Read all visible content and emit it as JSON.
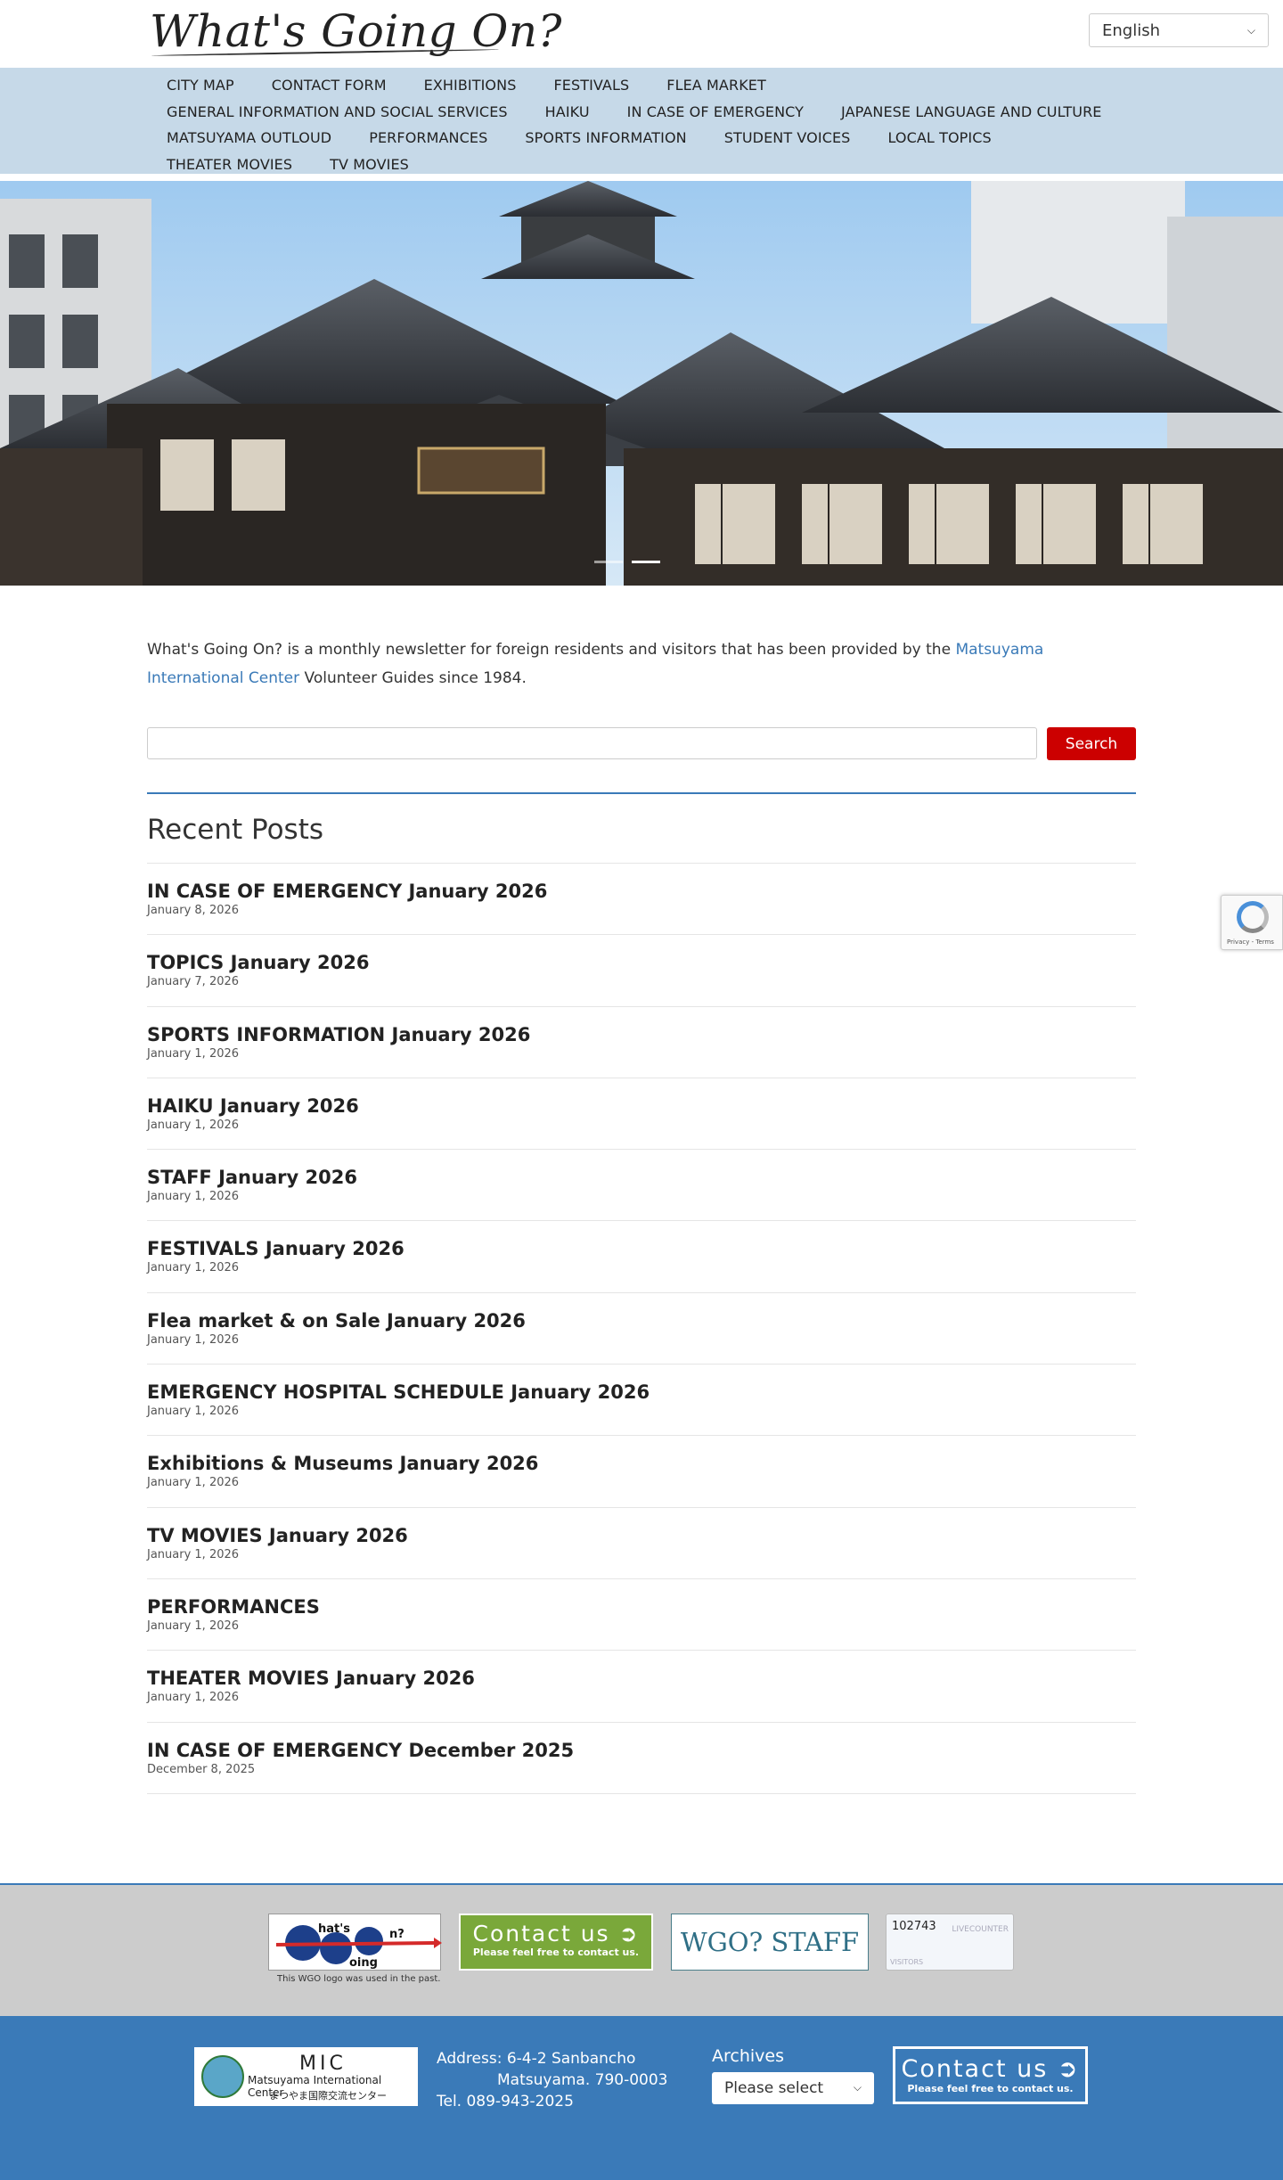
{
  "header": {
    "logo_text": "What's Going On?",
    "language": "English"
  },
  "nav": {
    "rows": [
      [
        "CITY MAP",
        "CONTACT FORM",
        "EXHIBITIONS",
        "FESTIVALS",
        "FLEA MARKET"
      ],
      [
        "GENERAL INFORMATION AND SOCIAL SERVICES",
        "HAIKU",
        "IN CASE OF EMERGENCY",
        "JAPANESE LANGUAGE AND CULTURE"
      ],
      [
        "MATSUYAMA OUTLOUD",
        "PERFORMANCES",
        "SPORTS INFORMATION",
        "STUDENT VOICES",
        "LOCAL TOPICS"
      ],
      [
        "THEATER MOVIES",
        "TV MOVIES"
      ]
    ]
  },
  "intro": {
    "before_link": "What's Going On? is a monthly newsletter for foreign residents and visitors that has been provided by the ",
    "link_text": "Matsuyama International Center",
    "after_link": " Volunteer Guides since 1984."
  },
  "search": {
    "button_label": "Search"
  },
  "recent": {
    "title": "Recent Posts",
    "posts": [
      {
        "title": "IN CASE OF EMERGENCY January 2026",
        "date": "January 8, 2026"
      },
      {
        "title": "TOPICS January 2026",
        "date": "January 7, 2026"
      },
      {
        "title": "SPORTS INFORMATION January 2026",
        "date": "January 1, 2026"
      },
      {
        "title": "HAIKU January 2026",
        "date": "January 1, 2026"
      },
      {
        "title": "STAFF January 2026",
        "date": "January 1, 2026"
      },
      {
        "title": "FESTIVALS January 2026",
        "date": "January 1, 2026"
      },
      {
        "title": "Flea market & on Sale January 2026",
        "date": "January 1, 2026"
      },
      {
        "title": "EMERGENCY HOSPITAL SCHEDULE January 2026",
        "date": "January 1, 2026"
      },
      {
        "title": "Exhibitions & Museums January 2026",
        "date": "January 1, 2026"
      },
      {
        "title": "TV MOVIES January 2026",
        "date": "January 1, 2026"
      },
      {
        "title": "PERFORMANCES",
        "date": "January 1, 2026"
      },
      {
        "title": "THEATER MOVIES January 2026",
        "date": "January 1, 2026"
      },
      {
        "title": "IN CASE OF EMERGENCY December 2025",
        "date": "December 8, 2025"
      }
    ]
  },
  "footer_banners": {
    "wgo_caption": "This WGO logo was used in the past.",
    "contact_big": "Contact us",
    "contact_small": "Please feel free to contact us.",
    "staff_label": "WGO? STAFF",
    "counter_value": "102743",
    "counter_brand": "LIVECOUNTER",
    "counter_sub": "VISITORS"
  },
  "footer_bottom": {
    "mic_title": "MIC",
    "mic_en": "Matsuyama International Center",
    "mic_jp": "まつやま国際交流センター",
    "address_line1": "Address: 6-4-2 Sanbancho",
    "address_line2": "Matsuyama. 790-0003",
    "tel": "Tel. 089-943-2025",
    "archives_label": "Archives",
    "archives_select": "Please select",
    "contact_big": "Contact us",
    "contact_small": "Please feel free to contact us."
  },
  "recaptcha": {
    "text": "Privacy - Terms"
  },
  "colors": {
    "nav_bg": "#c6d9e8",
    "link": "#3a7ab8",
    "search_button": "#cc0000",
    "footer_gray": "#cccccc",
    "footer_blue": "#3a7ab8",
    "contact_green": "#7aa83a"
  }
}
